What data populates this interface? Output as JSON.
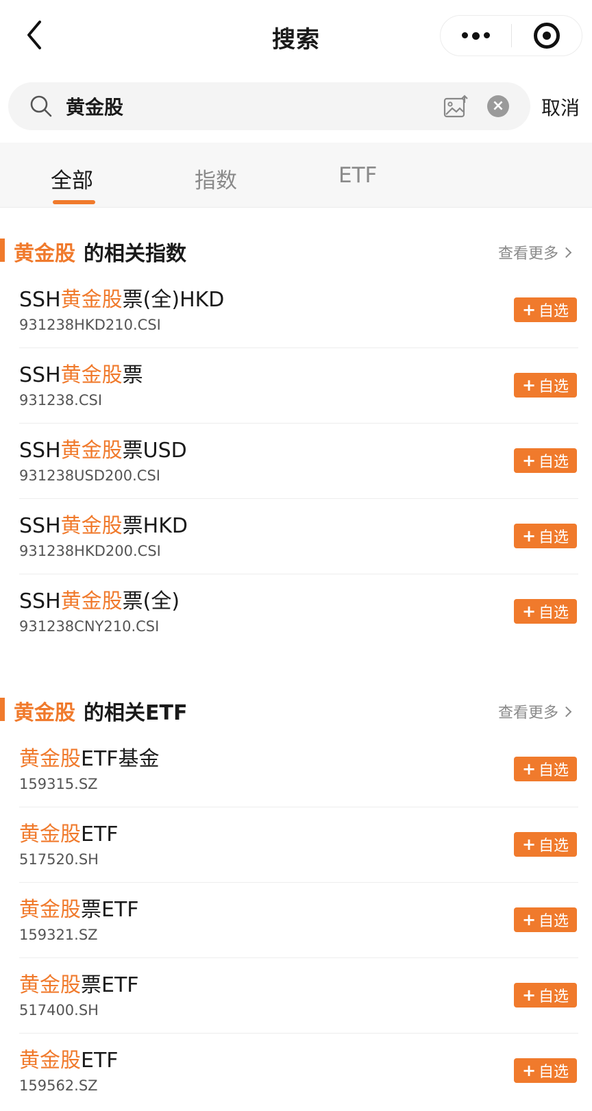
{
  "header": {
    "title": "搜索",
    "back_icon": "chevron-left-icon",
    "more_icon": "more-dots-icon",
    "close_icon": "target-circle-icon"
  },
  "search": {
    "query": "黄金股",
    "placeholder": "",
    "cancel_label": "取消"
  },
  "tabs": [
    {
      "label": "全部",
      "active": true
    },
    {
      "label": "指数",
      "active": false
    },
    {
      "label": "ETF",
      "active": false
    }
  ],
  "accent_color": "#f07a2c",
  "sections": [
    {
      "keyword": "黄金股",
      "title_suffix": "的相关指数",
      "more_label": "查看更多",
      "items": [
        {
          "prefix": "SSH",
          "keyword": "黄金股",
          "suffix": "票(全)HKD",
          "code": "931238HKD210.CSI",
          "button": "自选"
        },
        {
          "prefix": "SSH",
          "keyword": "黄金股",
          "suffix": "票",
          "code": "931238.CSI",
          "button": "自选"
        },
        {
          "prefix": "SSH",
          "keyword": "黄金股",
          "suffix": "票USD",
          "code": "931238USD200.CSI",
          "button": "自选"
        },
        {
          "prefix": "SSH",
          "keyword": "黄金股",
          "suffix": "票HKD",
          "code": "931238HKD200.CSI",
          "button": "自选"
        },
        {
          "prefix": "SSH",
          "keyword": "黄金股",
          "suffix": "票(全)",
          "code": "931238CNY210.CSI",
          "button": "自选"
        }
      ]
    },
    {
      "keyword": "黄金股",
      "title_suffix": "的相关ETF",
      "more_label": "查看更多",
      "items": [
        {
          "prefix": "",
          "keyword": "黄金股",
          "suffix": "ETF基金",
          "code": "159315.SZ",
          "button": "自选"
        },
        {
          "prefix": "",
          "keyword": "黄金股",
          "suffix": "ETF",
          "code": "517520.SH",
          "button": "自选"
        },
        {
          "prefix": "",
          "keyword": "黄金股",
          "suffix": "票ETF",
          "code": "159321.SZ",
          "button": "自选"
        },
        {
          "prefix": "",
          "keyword": "黄金股",
          "suffix": "票ETF",
          "code": "517400.SH",
          "button": "自选"
        },
        {
          "prefix": "",
          "keyword": "黄金股",
          "suffix": "ETF",
          "code": "159562.SZ",
          "button": "自选"
        }
      ]
    }
  ]
}
